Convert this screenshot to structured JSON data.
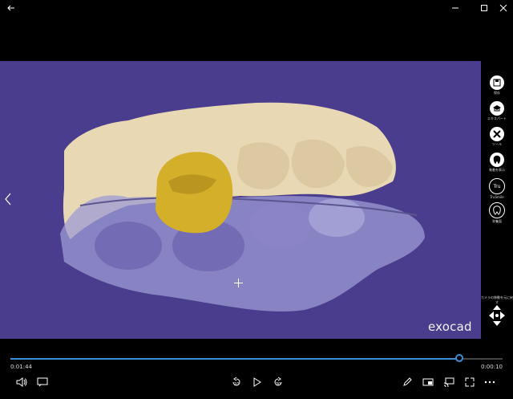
{
  "titlebar": {
    "back": "back-arrow",
    "min": "minimize",
    "max": "maximize",
    "close": "close"
  },
  "sidebar": {
    "items": [
      {
        "icon": "save-icon",
        "label": "保存"
      },
      {
        "icon": "graduation-cap-icon",
        "label": "エキスパート"
      },
      {
        "icon": "tools-icon",
        "label": "ツール"
      },
      {
        "icon": "tooth-icon",
        "label": "装着を表示"
      },
      {
        "icon": "tru-icon",
        "glyph": "Tru",
        "label": "TruSmile"
      },
      {
        "icon": "tooth-outline-icon",
        "label": "栄養面"
      }
    ],
    "camera_label": "カメラの移動を元に戻す"
  },
  "viewport": {
    "brand": "exocad"
  },
  "player": {
    "current_time": "0:01:44",
    "remaining_time": "0:00:10",
    "progress_fraction": 0.912,
    "skip_back": "10",
    "skip_forward": "30"
  },
  "colors": {
    "viewport_bg": "#4b3d8d",
    "accent": "#3a8fd6",
    "crown": "#d4af2a",
    "model": "#e9d8b4"
  }
}
